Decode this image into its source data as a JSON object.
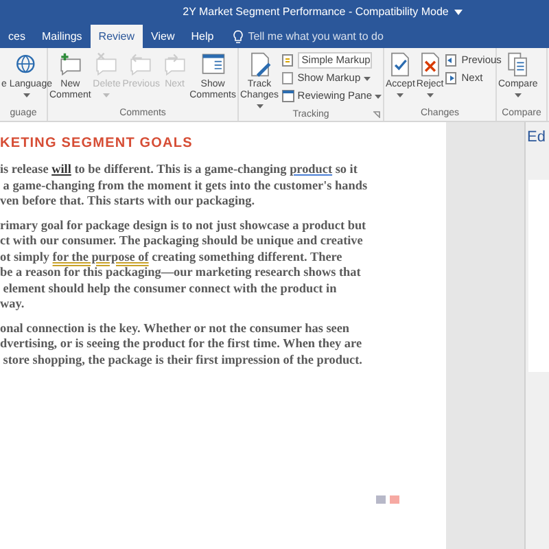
{
  "window": {
    "title": "2Y Market Segment Performance - Compatibility Mode"
  },
  "tabs": [
    {
      "label": "ces",
      "selected": false
    },
    {
      "label": "Mailings",
      "selected": false
    },
    {
      "label": "Review",
      "selected": true
    },
    {
      "label": "View",
      "selected": false
    },
    {
      "label": "Help",
      "selected": false
    }
  ],
  "tell_me": {
    "placeholder": "Tell me what you want to do"
  },
  "ribbon": [
    {
      "label": "guage",
      "items": [
        {
          "kind": "large",
          "lines": [
            "e Language"
          ],
          "dropdown": true,
          "disabled": false
        }
      ]
    },
    {
      "label": "Comments",
      "items": [
        {
          "kind": "large",
          "lines": [
            "New",
            "Comment"
          ],
          "dropdown": false,
          "disabled": false
        },
        {
          "kind": "large",
          "lines": [
            "Delete"
          ],
          "dropdown": true,
          "disabled": true
        },
        {
          "kind": "large",
          "lines": [
            "Previous"
          ],
          "dropdown": false,
          "disabled": true
        },
        {
          "kind": "large",
          "lines": [
            "Next"
          ],
          "dropdown": false,
          "disabled": true
        },
        {
          "kind": "large",
          "lines": [
            "Show",
            "Comments"
          ],
          "dropdown": false,
          "disabled": false
        }
      ]
    },
    {
      "label": "Tracking",
      "launcher": true,
      "items": [
        {
          "kind": "large",
          "lines": [
            "Track",
            "Changes"
          ],
          "dropdown": true,
          "disabled": false
        },
        {
          "kind": "stack",
          "rows": [
            {
              "kind": "select",
              "label": "Simple Markup"
            },
            {
              "kind": "small",
              "label": "Show Markup",
              "dropdown": true
            },
            {
              "kind": "small",
              "label": "Reviewing Pane",
              "dropdown": true
            }
          ]
        }
      ]
    },
    {
      "label": "Changes",
      "items": [
        {
          "kind": "large",
          "lines": [
            "Accept"
          ],
          "dropdown": true,
          "disabled": false
        },
        {
          "kind": "large",
          "lines": [
            "Reject"
          ],
          "dropdown": true,
          "disabled": false
        },
        {
          "kind": "stack",
          "rows": [
            {
              "kind": "small",
              "label": "Previous",
              "dropdown": false
            },
            {
              "kind": "small",
              "label": "Next",
              "dropdown": false
            }
          ]
        }
      ]
    },
    {
      "label": "Compare",
      "items": [
        {
          "kind": "large",
          "lines": [
            "Compare"
          ],
          "dropdown": true,
          "disabled": false
        }
      ]
    }
  ],
  "document": {
    "heading": "KETING SEGMENT GOALS",
    "paragraphs": [
      [
        [
          {
            "text": "is release "
          },
          {
            "text": "will",
            "kind": "bold"
          },
          {
            "text": " to be different. This is a game-changing "
          },
          {
            "text": "product",
            "kind": "spelling"
          },
          {
            "text": " so it"
          }
        ],
        [
          {
            "text": " a game-changing from the moment it gets into the customer's hands"
          }
        ],
        [
          {
            "text": "ven before that. This starts with our packaging."
          }
        ]
      ],
      [
        [
          {
            "text": "rimary goal for package design is to not just showcase a product but"
          }
        ],
        [
          {
            "text": "ct with our consumer. The packaging should be unique and creative"
          }
        ],
        [
          {
            "text": "ot simply "
          },
          {
            "text": "for the purpose of",
            "kind": "grammar"
          },
          {
            "text": " creating something different. There"
          }
        ],
        [
          {
            "text": "be a reason for this packaging—our marketing research shows that"
          }
        ],
        [
          {
            "text": " element should help the consumer connect with the product in"
          }
        ],
        [
          {
            "text": "way."
          }
        ]
      ],
      [
        [
          {
            "text": "onal connection is the key. Whether or not the consumer has seen"
          }
        ],
        [
          {
            "text": "dvertising, or is seeing the product for the first time. When they are"
          }
        ],
        [
          {
            "text": " store shopping, the package is their first impression of the product."
          }
        ]
      ]
    ]
  },
  "side_pane": {
    "title": "Ed"
  }
}
